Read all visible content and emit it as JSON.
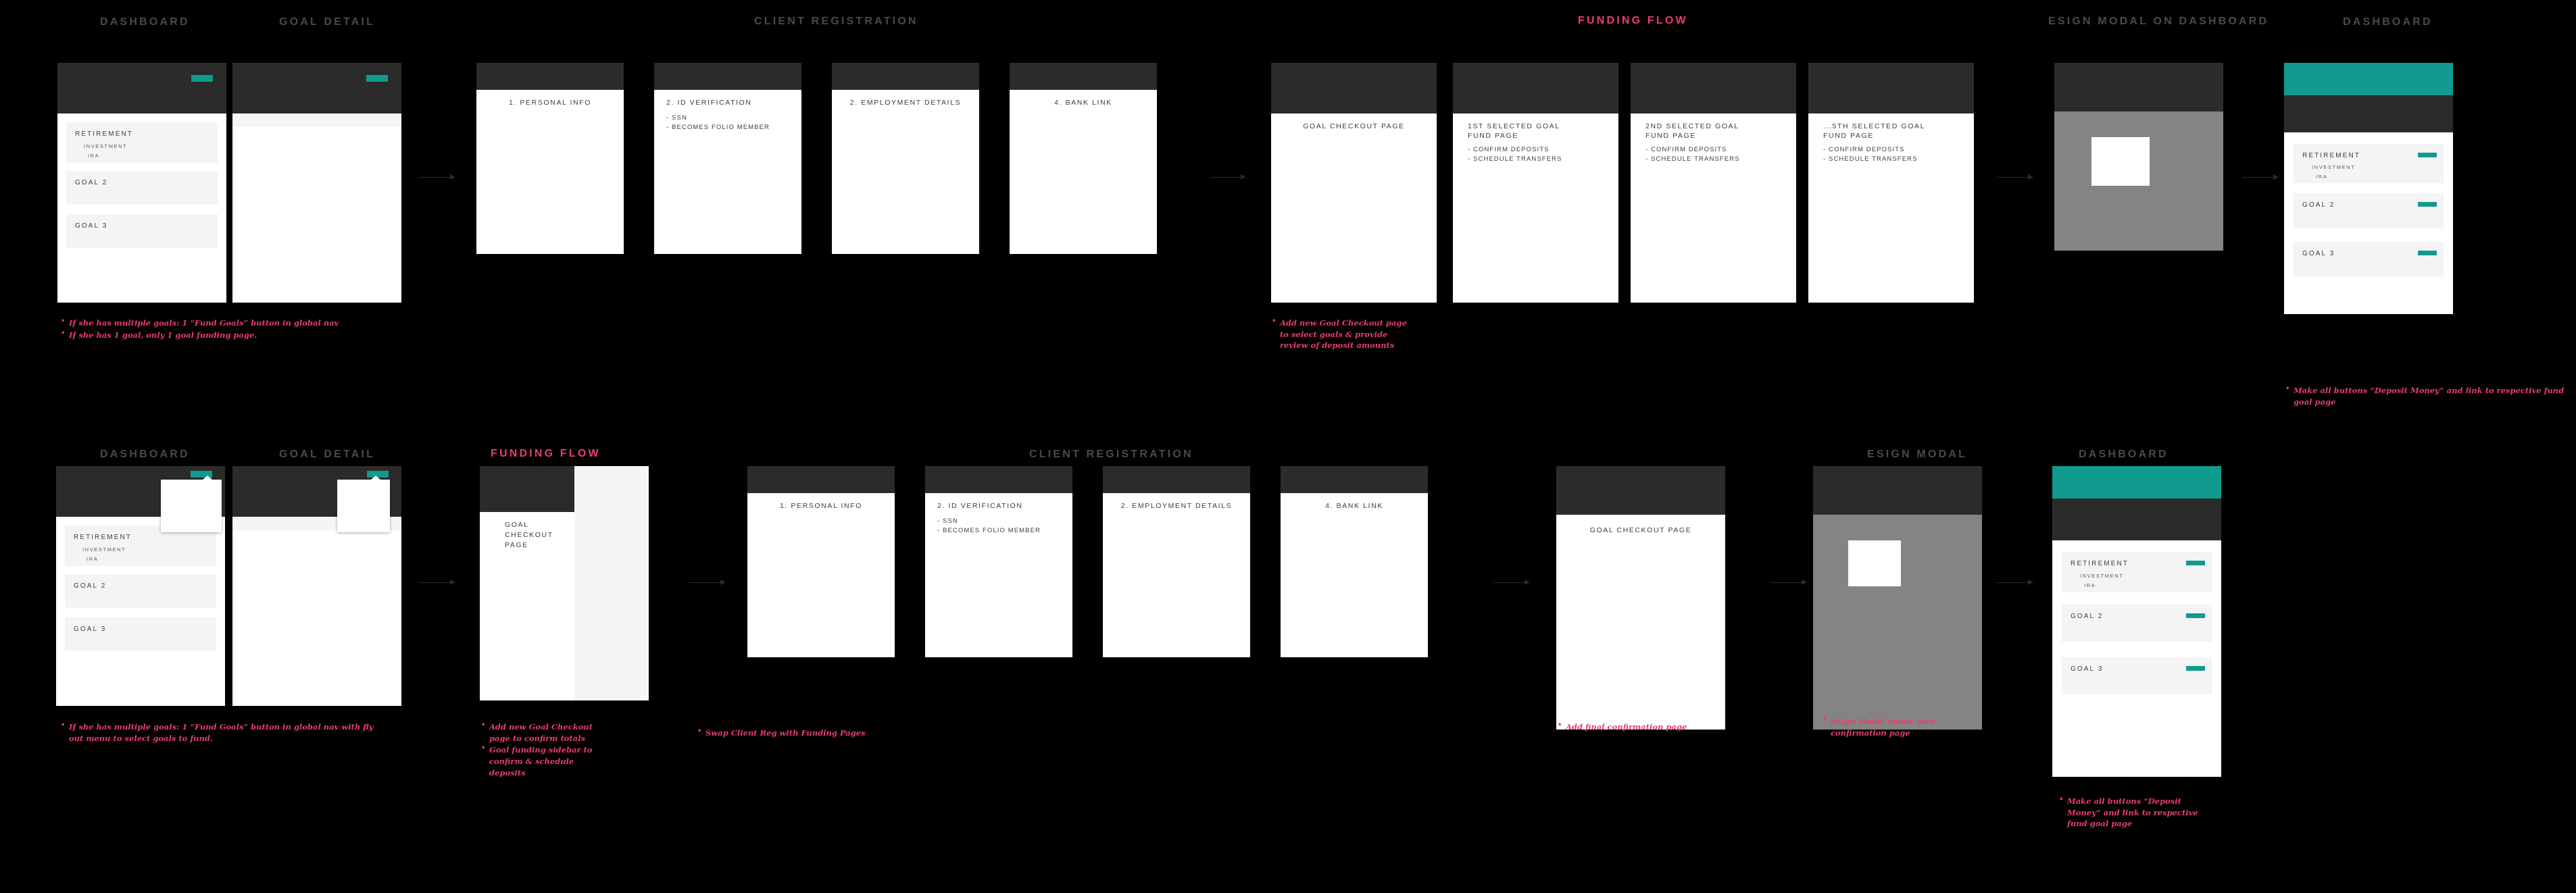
{
  "meta": {
    "colors": {
      "background": "#000000",
      "teal": "#109b8e",
      "dark_nav": "#2b2b2a",
      "annotation_pink": "#e83e6b",
      "section_label_gray": "#4a4a4a",
      "goal_row_gray": "#f4f4f4",
      "overlay_gray": "#848484"
    }
  },
  "section_labels": {
    "row1": {
      "dashboard": "DASHBOARD",
      "goal_detail": "GOAL DETAIL",
      "client_registration": "CLIENT REGISTRATION",
      "funding_flow": "FUNDING FLOW",
      "esign_modal_on_dashboard": "ESIGN MODAL ON DASHBOARD",
      "dashboard_final": "DASHBOARD"
    },
    "row2": {
      "dashboard": "DASHBOARD",
      "goal_detail": "GOAL DETAIL",
      "funding_flow": "FUNDING FLOW",
      "client_registration": "CLIENT REGISTRATION",
      "esign_modal": "ESIGN MODAL",
      "dashboard_final": "DASHBOARD"
    }
  },
  "dashboard": {
    "goals": [
      {
        "title": "RETIREMENT",
        "subitems": [
          "INVESTMENT",
          "IRA"
        ]
      },
      {
        "title": "GOAL 2",
        "subitems": []
      },
      {
        "title": "GOAL 3",
        "subitems": []
      }
    ]
  },
  "client_registration_steps": [
    {
      "title": "1. PERSONAL INFO",
      "details": ""
    },
    {
      "title": "2. ID VERIFICATION",
      "details": "- SSN\n- BECOMES FOLIO MEMBER"
    },
    {
      "title": "2. EMPLOYMENT DETAILS",
      "details": ""
    },
    {
      "title": "4. BANK LINK",
      "details": ""
    }
  ],
  "funding_flow_row1": [
    {
      "title": "GOAL CHECKOUT PAGE",
      "details": ""
    },
    {
      "title": "1ST SELECTED GOAL\nFUND PAGE",
      "details": "- CONFIRM DEPOSITS\n- SCHEDULE TRANSFERS"
    },
    {
      "title": "2ND SELECTED GOAL\nFUND PAGE",
      "details": "- CONFIRM DEPOSITS\n- SCHEDULE TRANSFERS"
    },
    {
      "title": "...5TH SELECTED GOAL\nFUND PAGE",
      "details": "- CONFIRM DEPOSITS\n- SCHEDULE TRANSFERS"
    }
  ],
  "funding_flow_row2": {
    "checkout_title": "GOAL\nCHECKOUT\nPAGE"
  },
  "goal_checkout_row2": {
    "title": "GOAL CHECKOUT PAGE"
  },
  "notes": {
    "row1_dashboard": [
      "If she has multiple goals: 1 “Fund Goals” button in global nav",
      "If she has 1 goal, only 1 goal funding page."
    ],
    "row1_funding": [
      "Add new Goal Checkout page to select goals & provide review of deposit amounts"
    ],
    "row1_dashboard_final": [
      "Make all buttons “Deposit Money” and link to respective fund goal page"
    ],
    "row2_dashboard": [
      "If she has multiple goals: 1 “Fund Goals” button in global nav with fly out menu to select goals to fund."
    ],
    "row2_funding": [
      "Add new Goal Checkout page to confirm totals",
      "Goal funding sidebar to confirm & schedule deposits"
    ],
    "row2_swap": [
      "Swap Client Reg with Funding Pages"
    ],
    "row2_confirmation": [
      "Add final confirmation page"
    ],
    "row2_esign": [
      "eSign Modal opens over confirmation page"
    ],
    "row2_dashboard_final": [
      "Make all buttons “Deposit Money” and link to respective fund goal page"
    ]
  }
}
